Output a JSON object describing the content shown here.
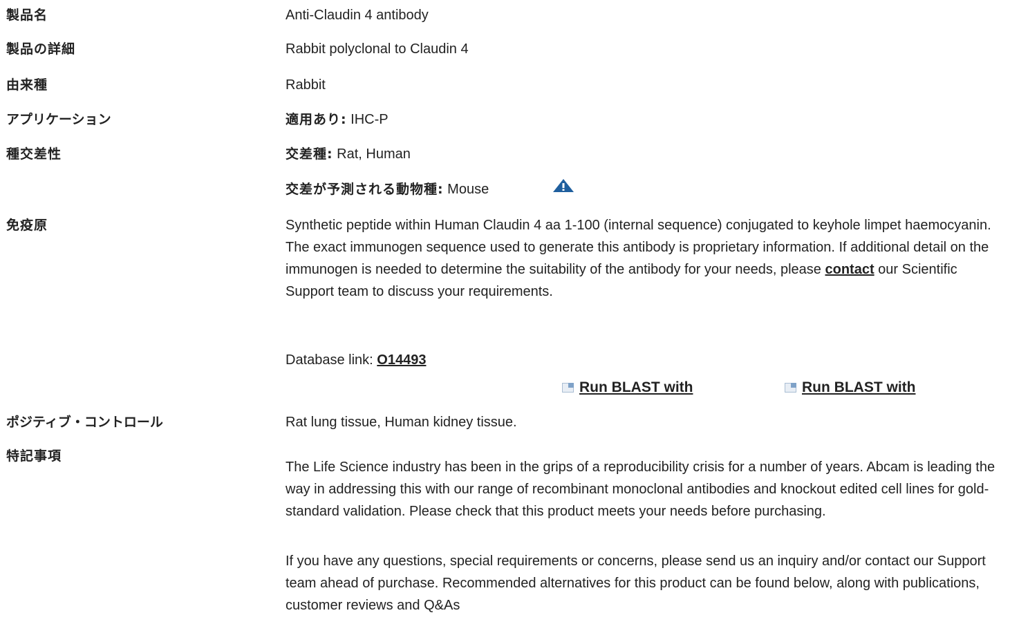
{
  "rows": {
    "product_name": {
      "label": "製品名",
      "value": "Anti-Claudin 4 antibody"
    },
    "product_details": {
      "label": "製品の詳細",
      "value": "Rabbit polyclonal to Claudin 4"
    },
    "host": {
      "label": "由来種",
      "value": "Rabbit"
    },
    "applications": {
      "label": "アプリケーション",
      "prefix": "適用あり:",
      "value": " IHC-P"
    },
    "reactivity": {
      "label": "種交差性",
      "prefix": "交差種:",
      "value": " Rat, Human",
      "predicted_prefix": "交差が予測される動物種:",
      "predicted_value": " Mouse",
      "warning_icon": "warning-triangle-icon"
    },
    "immunogen": {
      "label": "免疫原",
      "text_before_link": "Synthetic peptide within Human Claudin 4 aa 1-100 (internal sequence) conjugated to keyhole limpet haemocyanin. The exact immunogen sequence used to generate this antibody is proprietary information. If additional detail on the immunogen is needed to determine the suitability of the antibody for your needs, please ",
      "link_text": "contact",
      "text_after_link": " our Scientific Support team to discuss your requirements.",
      "db_label": "Database link: ",
      "db_link": "O14493",
      "blast_1": "Run BLAST with",
      "blast_2": "Run BLAST with",
      "blast_icon": "external-link-icon"
    },
    "positive_control": {
      "label": "ポジティブ・コントロール",
      "value": "Rat lung tissue, Human kidney tissue."
    },
    "notes": {
      "label": "特記事項",
      "para1": "The Life Science industry has been in the grips of a reproducibility crisis for a number of years. Abcam is leading the way in addressing this with our range of recombinant monoclonal antibodies and knockout edited cell lines for gold-standard validation. Please check that this product meets your needs before purchasing.",
      "para2": "If you have any questions, special requirements or concerns, please send us an inquiry and/or contact our Support team ahead of purchase. Recommended alternatives for this product can be found below, along with publications, customer reviews and Q&As"
    }
  },
  "colors": {
    "warning_icon": "#1f5f9e",
    "text": "#222222"
  }
}
